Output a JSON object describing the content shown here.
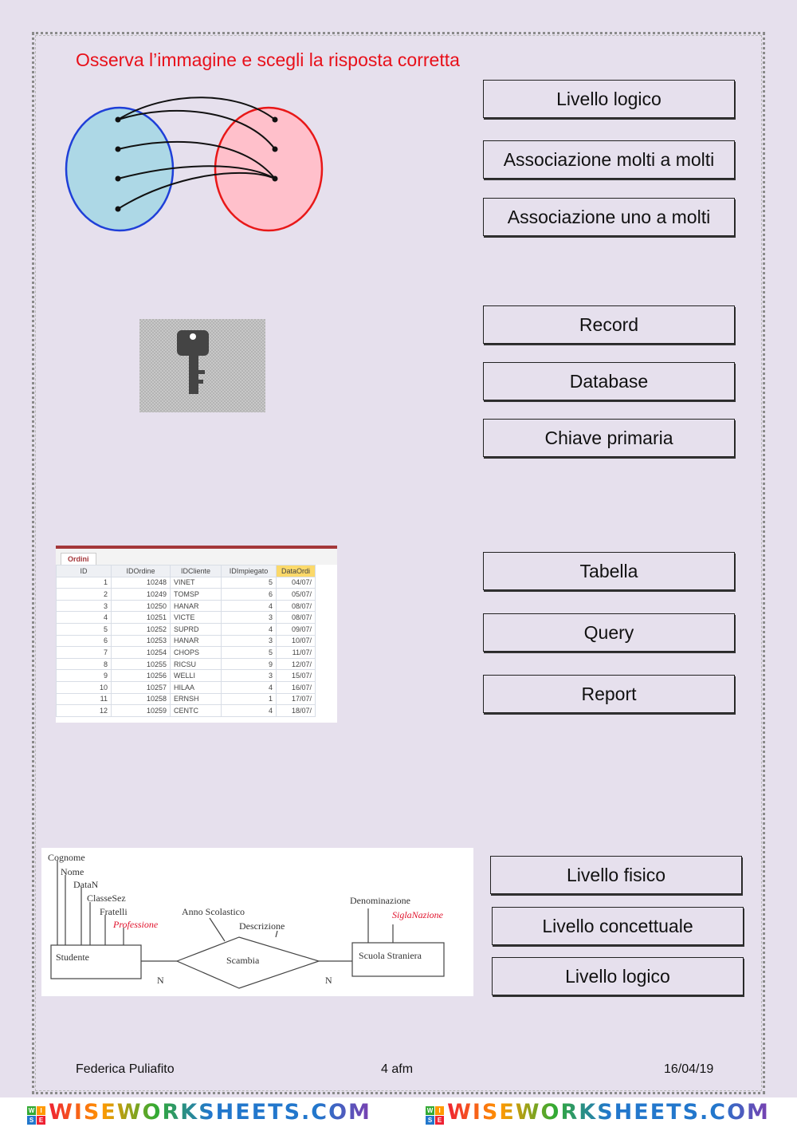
{
  "title": "Osserva l’immagine e scegli la risposta corretta",
  "groups": [
    {
      "options": [
        "Livello logico",
        "Associazione molti a molti",
        "Associazione uno a molti"
      ]
    },
    {
      "options": [
        "Record",
        "Database",
        "Chiave primaria"
      ]
    },
    {
      "options": [
        "Tabella",
        "Query",
        "Report"
      ]
    },
    {
      "options": [
        "Livello fisico",
        "Livello concettuale",
        "Livello logico"
      ]
    }
  ],
  "table_image": {
    "tab": "Ordini",
    "headers": [
      "ID",
      "IDOrdine",
      "IDCliente",
      "IDImpiegato",
      "DataOrdi"
    ],
    "rows": [
      [
        "1",
        "10248",
        "VINET",
        "5",
        "04/07/"
      ],
      [
        "2",
        "10249",
        "TOMSP",
        "6",
        "05/07/"
      ],
      [
        "3",
        "10250",
        "HANAR",
        "4",
        "08/07/"
      ],
      [
        "4",
        "10251",
        "VICTE",
        "3",
        "08/07/"
      ],
      [
        "5",
        "10252",
        "SUPRD",
        "4",
        "09/07/"
      ],
      [
        "6",
        "10253",
        "HANAR",
        "3",
        "10/07/"
      ],
      [
        "7",
        "10254",
        "CHOPS",
        "5",
        "11/07/"
      ],
      [
        "8",
        "10255",
        "RICSU",
        "9",
        "12/07/"
      ],
      [
        "9",
        "10256",
        "WELLI",
        "3",
        "15/07/"
      ],
      [
        "10",
        "10257",
        "HILAA",
        "4",
        "16/07/"
      ],
      [
        "11",
        "10258",
        "ERNSH",
        "1",
        "17/07/"
      ],
      [
        "12",
        "10259",
        "CENTC",
        "4",
        "18/07/"
      ]
    ]
  },
  "er_image": {
    "entity1": "Studente",
    "entity2": "Scuola Straniera",
    "relation": "Scambia",
    "attrs1": [
      "Cognome",
      "Nome",
      "DataN",
      "ClasseSez",
      "Fratelli",
      "Professione"
    ],
    "rel_attrs": [
      "Anno Scolastico",
      "Descrizione"
    ],
    "attrs2": [
      "Denominazione",
      "SiglaNazione"
    ],
    "card1": "N",
    "card2": "N"
  },
  "footer": {
    "author": "Federica Puliafito",
    "class": "4 afm",
    "date": "16/04/19"
  },
  "banner": {
    "text": "WISEWORKSHEETS.COM",
    "logo": [
      "W",
      "I",
      "S",
      "E"
    ]
  },
  "colors": {
    "title": "#e8101a",
    "background": "#e6e0ed",
    "set_a": "#add8e6",
    "set_b": "#ffc0cb"
  }
}
